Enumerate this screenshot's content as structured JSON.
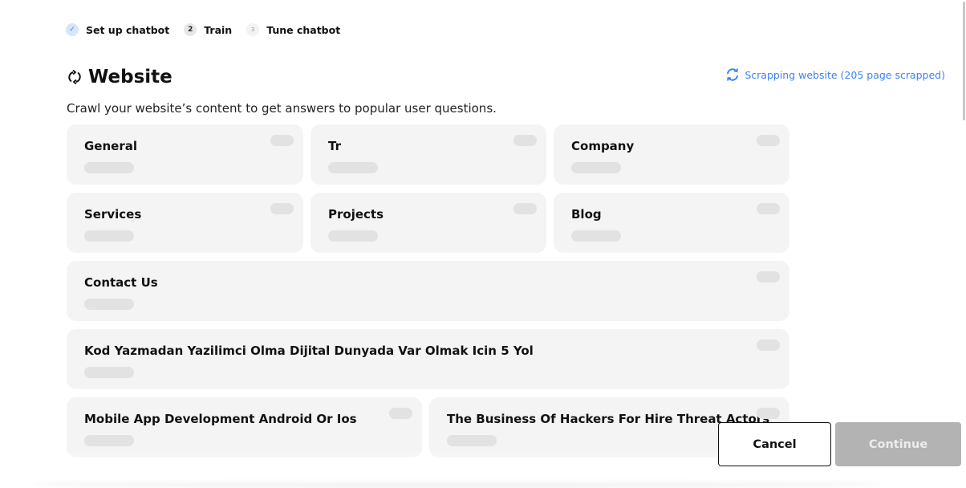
{
  "stepper": {
    "steps": [
      {
        "index": "✓",
        "label": "Set up chatbot",
        "state": "done"
      },
      {
        "index": "2",
        "label": "Train",
        "state": "active"
      },
      {
        "index": "3",
        "label": "Tune chatbot",
        "state": "future"
      }
    ]
  },
  "header": {
    "title": "Website",
    "subtitle": "Crawl your website’s content to get answers to popular user questions.",
    "status": "Scrapping website (205 page scrapped)"
  },
  "cards": [
    {
      "title": "General"
    },
    {
      "title": "Tr"
    },
    {
      "title": "Company"
    },
    {
      "title": "Services"
    },
    {
      "title": "Projects"
    },
    {
      "title": "Blog"
    },
    {
      "title": "Contact Us"
    },
    {
      "title": "Kod Yazmadan Yazilimci Olma Dijital Dunyada Var Olmak Icin 5 Yol"
    },
    {
      "title": "Mobile App Development Android Or Ios"
    },
    {
      "title": "The Business Of Hackers For Hire Threat Actors"
    }
  ],
  "actions": {
    "cancel_label": "Cancel",
    "continue_label": "Continue"
  },
  "colors": {
    "accent": "#3b82f6",
    "card_bg": "#f4f4f4",
    "continue_disabled": "#b3b3b3"
  }
}
